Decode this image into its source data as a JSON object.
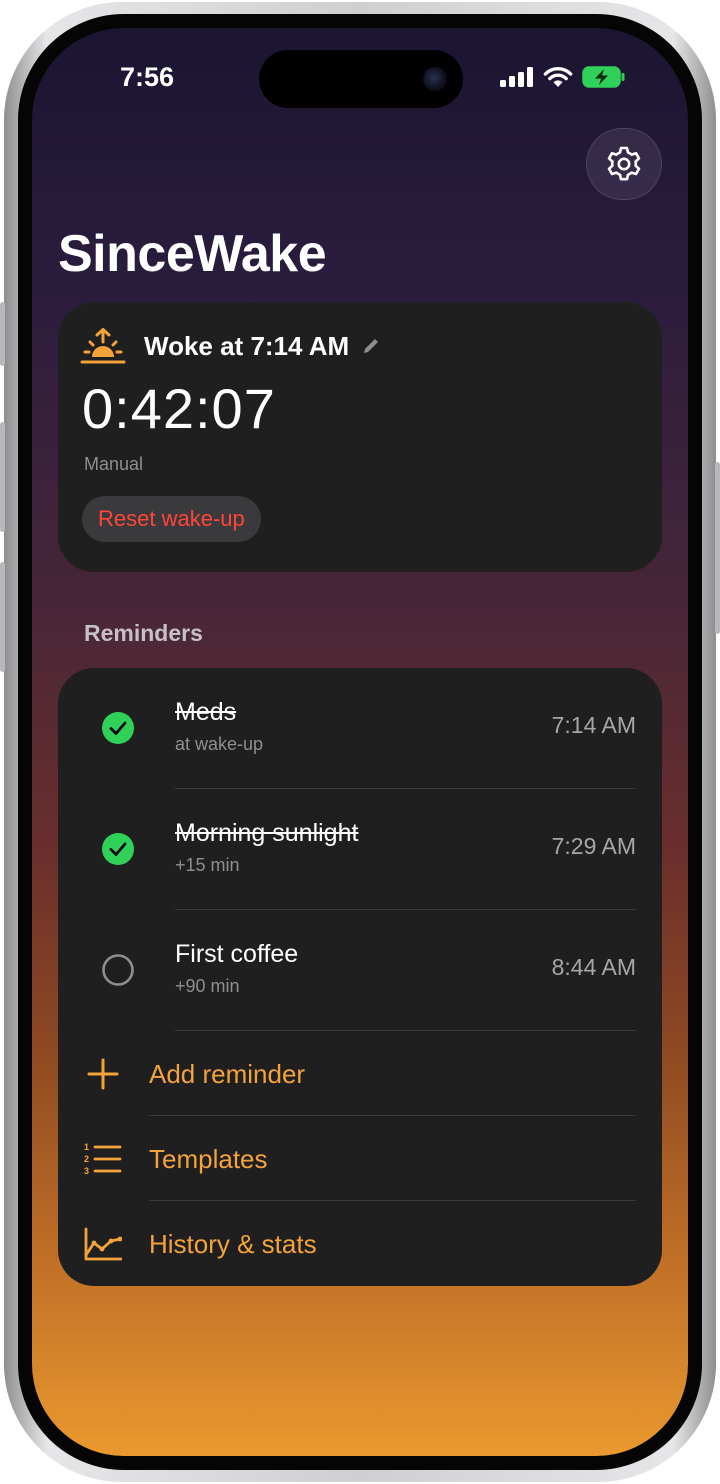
{
  "status_bar": {
    "time": "7:56",
    "signal_icon": "cellular-signal-icon",
    "wifi_icon": "wifi-icon",
    "battery_icon": "battery-charging-icon"
  },
  "header": {
    "settings_icon": "gear-icon",
    "title": "SinceWake"
  },
  "wake_card": {
    "icon": "sunrise-icon",
    "label": "Woke at 7:14 AM",
    "edit_icon": "pencil-icon",
    "elapsed": "0:42:07",
    "source": "Manual",
    "reset_label": "Reset wake-up"
  },
  "reminders": {
    "section_title": "Reminders",
    "items": [
      {
        "title": "Meds",
        "subtitle": "at wake-up",
        "time": "7:14 AM",
        "done": true
      },
      {
        "title": "Morning sunlight",
        "subtitle": "+15 min",
        "time": "7:29 AM",
        "done": true
      },
      {
        "title": "First coffee",
        "subtitle": "+90 min",
        "time": "8:44 AM",
        "done": false
      }
    ],
    "actions": [
      {
        "label": "Add reminder",
        "icon": "plus-icon"
      },
      {
        "label": "Templates",
        "icon": "numbered-list-icon"
      },
      {
        "label": "History & stats",
        "icon": "line-chart-icon"
      }
    ]
  },
  "colors": {
    "accent": "#f4a33a",
    "check_green": "#30d158",
    "destructive": "#ff453a",
    "card": "#1f1f20"
  }
}
